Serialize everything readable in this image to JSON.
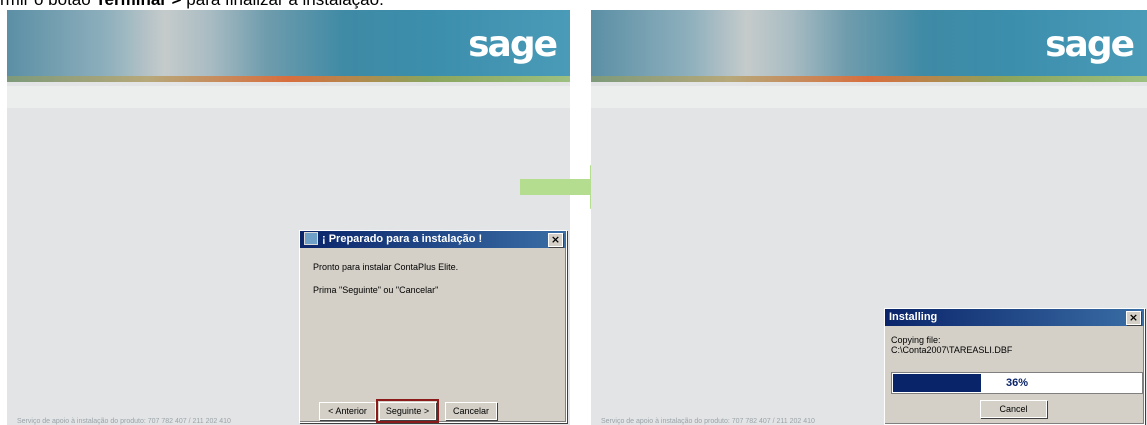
{
  "caption": {
    "prefix": "rmir o botão ",
    "bold": "Terminar >",
    "suffix": " para finalizar a instalação."
  },
  "brand": {
    "logo": "sage"
  },
  "footer": "Serviço de apoio à instalação do produto: 707 782 407 / 211 202 410",
  "left_dialog": {
    "title": "¡ Preparado para a instalação !",
    "line1": "Pronto para instalar ContaPlus Elite.",
    "line2": "Prima \"Seguinte\" ou \"Cancelar\"",
    "back_label": "< Anterior",
    "next_label": "Seguinte >",
    "cancel_label": "Cancelar",
    "close_glyph": "×"
  },
  "right_dialog": {
    "title": "Installing",
    "line1": "Copying file:",
    "line2": "C:\\Conta2007\\TAREASLI.DBF",
    "progress_percent": 36,
    "progress_label": "36%",
    "cancel_label": "Cancel",
    "close_glyph": "×"
  },
  "colors": {
    "accent_arrow": "#b5dd8f",
    "titlebar": "#0a246a",
    "highlight": "#8b1a1a"
  }
}
